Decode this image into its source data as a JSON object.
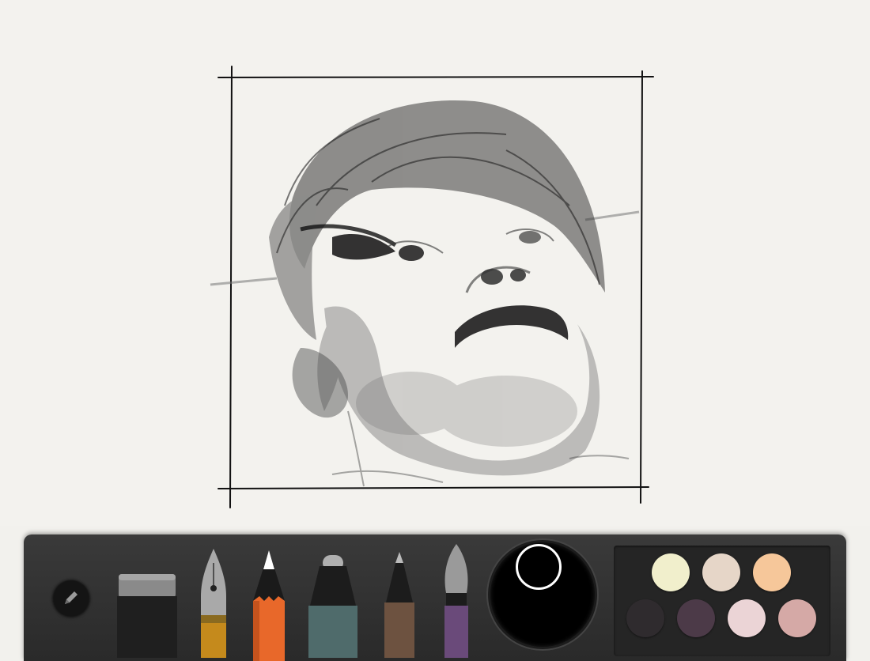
{
  "app": {
    "accent": "#000000"
  },
  "toolbar": {
    "tools": [
      {
        "name": "pencil-mode-button",
        "icon": "pencil-icon"
      },
      {
        "name": "eraser-tool",
        "icon": "eraser-icon"
      },
      {
        "name": "fountain-pen-tool",
        "icon": "fountain-pen-icon"
      },
      {
        "name": "pencil-tool",
        "icon": "pencil-icon"
      },
      {
        "name": "marker-tool",
        "icon": "marker-icon"
      },
      {
        "name": "pen-tool",
        "icon": "pen-icon"
      },
      {
        "name": "brush-tool",
        "icon": "brush-icon"
      }
    ],
    "selected_tool": "pencil-tool",
    "current_color": "#000000",
    "palette": [
      "#f1efcc",
      "#e6d6c8",
      "#f6c79a",
      "#2f2b2e",
      "#4c3a48",
      "#ebd4d6",
      "#d5a9a6"
    ]
  }
}
